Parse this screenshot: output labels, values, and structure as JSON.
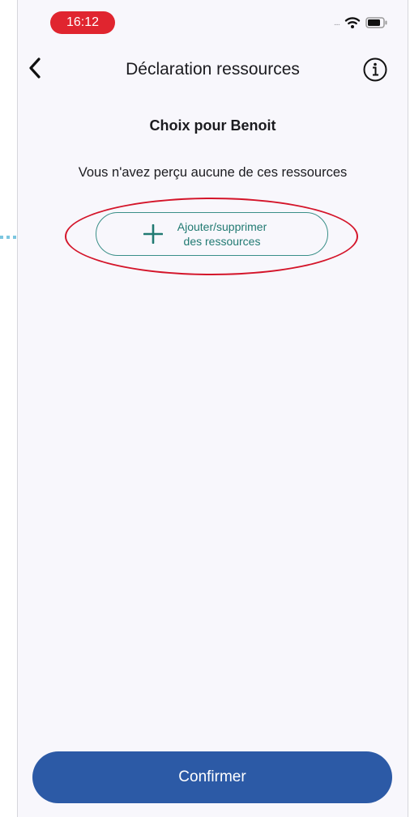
{
  "status_bar": {
    "time": "16:12",
    "signal": "....",
    "time_badge_color": "#e0252f"
  },
  "nav": {
    "back_icon": "chevron-left-icon",
    "title": "Déclaration ressources",
    "info_icon": "info-circle-icon"
  },
  "content": {
    "person_title": "Choix pour Benoit",
    "empty_message": "Vous n'avez perçu aucune de ces ressources",
    "add_button": {
      "icon": "plus-icon",
      "label_line1": "Ajouter/supprimer",
      "label_line2": "des ressources",
      "accent_color": "#217a72"
    }
  },
  "annotations": {
    "highlight_color": "#d4152a",
    "arrow_color": "#7cc6e0"
  },
  "footer": {
    "confirm_label": "Confirmer",
    "confirm_color": "#2c5aa6"
  }
}
